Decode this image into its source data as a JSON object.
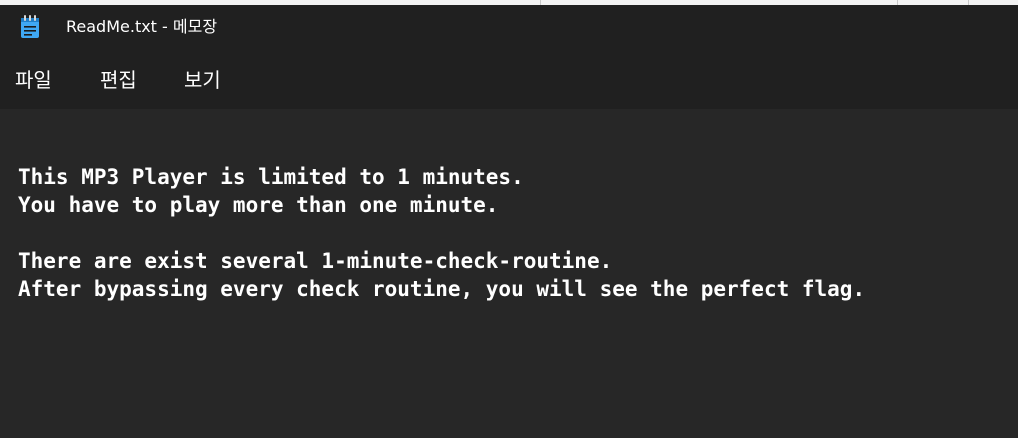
{
  "window": {
    "title": "ReadMe.txt - 메모장",
    "app_icon": "notepad-icon"
  },
  "menubar": {
    "file_label": "파일",
    "edit_label": "편집",
    "view_label": "보기"
  },
  "editor": {
    "lines": [
      "This MP3 Player is limited to 1 minutes.",
      "You have to play more than one minute.",
      "",
      "There are exist several 1-minute-check-routine.",
      "After bypassing every check routine, you will see the perfect flag."
    ]
  },
  "colors": {
    "titlebar_bg": "#202020",
    "editor_bg": "#272727",
    "text": "#ffffff",
    "icon_blue": "#3fa9f5"
  }
}
